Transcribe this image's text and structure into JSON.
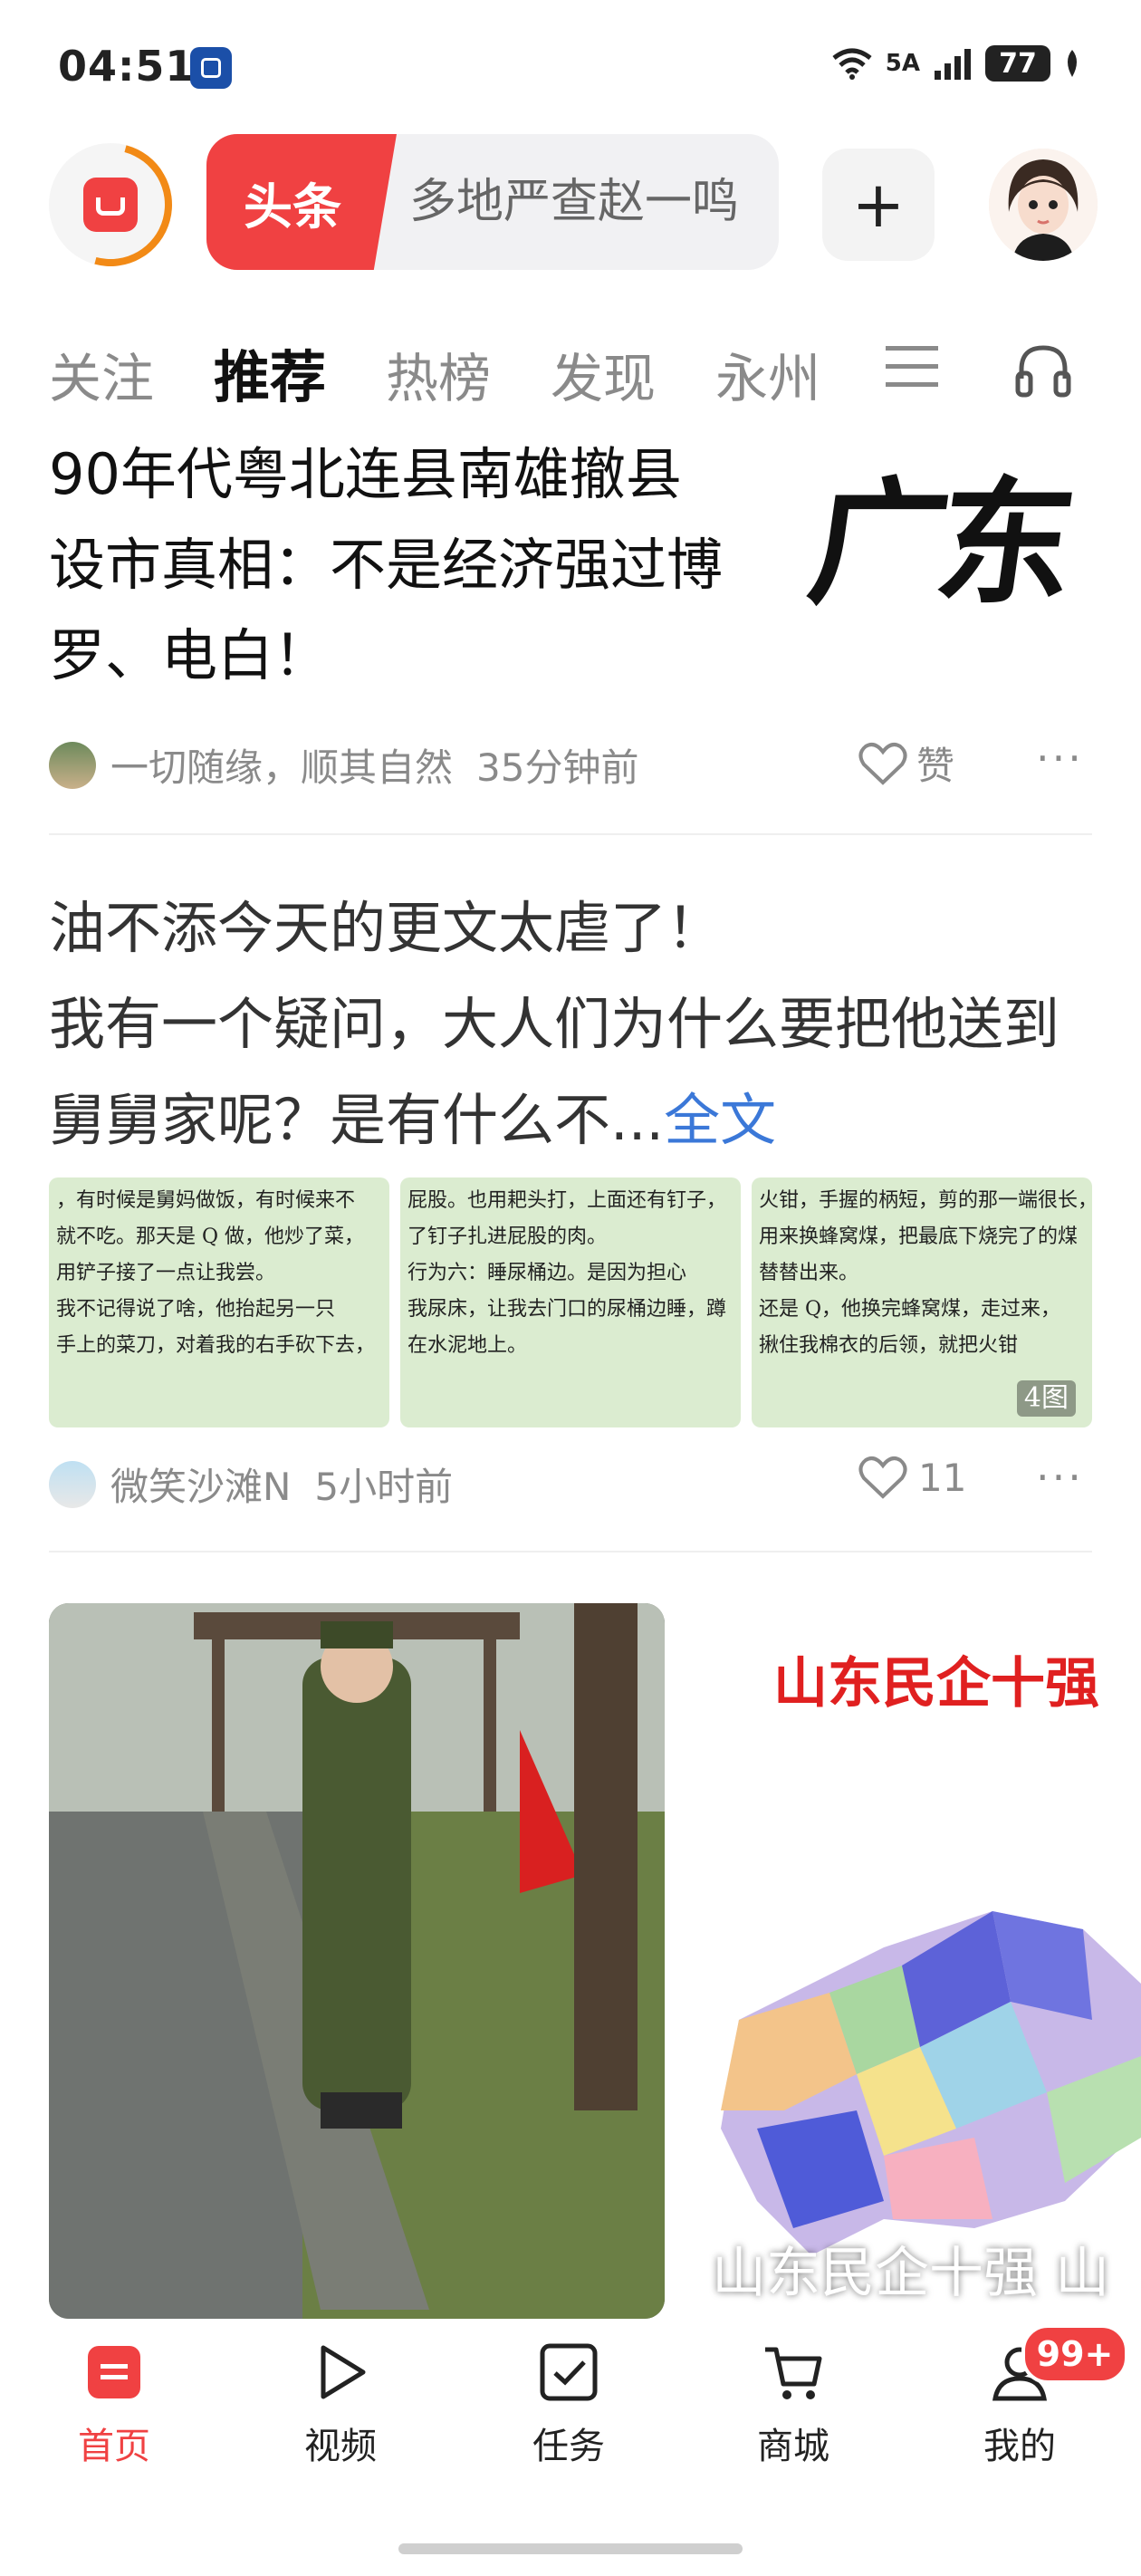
{
  "status_bar": {
    "time": "04:51",
    "network": "5A",
    "battery": "77"
  },
  "header": {
    "search_tag": "头条",
    "search_query": "多地严查赵一鸣",
    "plus_label": "+"
  },
  "tabs": [
    {
      "label": "关注",
      "active": false
    },
    {
      "label": "推荐",
      "active": true
    },
    {
      "label": "热榜",
      "active": false
    },
    {
      "label": "发现",
      "active": false
    },
    {
      "label": "永州",
      "active": false
    }
  ],
  "article1": {
    "title": "90年代粤北连县南雄撤县设市真相：不是经济强过博罗、电白！",
    "thumb_text": "广东",
    "author": "一切随缘，顺其自然",
    "time": "35分钟前",
    "like_label": "赞",
    "more": "···"
  },
  "article2": {
    "title_line1": "油不添今天的更文太虐了！",
    "title_rest": "我有一个疑问，大人们为什么要把他送到舅舅家呢？是有什么不...",
    "more_link": "全文",
    "images": [
      {
        "lines": [
          "，有时候是舅妈做饭，有时候来不",
          "就不吃。那天是 Q 做，他炒了菜，",
          "用铲子接了一点让我尝。",
          "",
          "我不记得说了啥，他抬起另一只",
          "手上的菜刀，对着我的右手砍下去，"
        ]
      },
      {
        "lines": [
          "屁股。也用耙头打，上面还有钉子，",
          "了钉子扎进屁股的肉。",
          "",
          "行为六：睡尿桶边。是因为担心",
          "我尿床，让我去门口的尿桶边睡，蹲",
          "在水泥地上。"
        ]
      },
      {
        "lines": [
          "火钳，手握的柄短，剪的那一端很长，",
          "用来换蜂窝煤，把最底下烧完了的煤",
          "替替出来。",
          "",
          "还是 Q，他换完蜂窝煤，走过来，",
          "揪住我棉衣的后领，就把火钳"
        ]
      }
    ],
    "image_count": "4图",
    "author": "微笑沙滩N",
    "time": "5小时前",
    "likes": "11",
    "more": "···"
  },
  "cards": {
    "right_title": "山东民企十强",
    "right_caption": "山东民企十强 山"
  },
  "bottom_nav": [
    {
      "label": "首页",
      "active": true
    },
    {
      "label": "视频",
      "active": false
    },
    {
      "label": "任务",
      "active": false
    },
    {
      "label": "商城",
      "active": false
    },
    {
      "label": "我的",
      "active": false
    }
  ],
  "badge": "99+",
  "colors": {
    "brand_red": "#f04142",
    "accent_orange": "#f28a16",
    "link_blue": "#3b78d8"
  }
}
